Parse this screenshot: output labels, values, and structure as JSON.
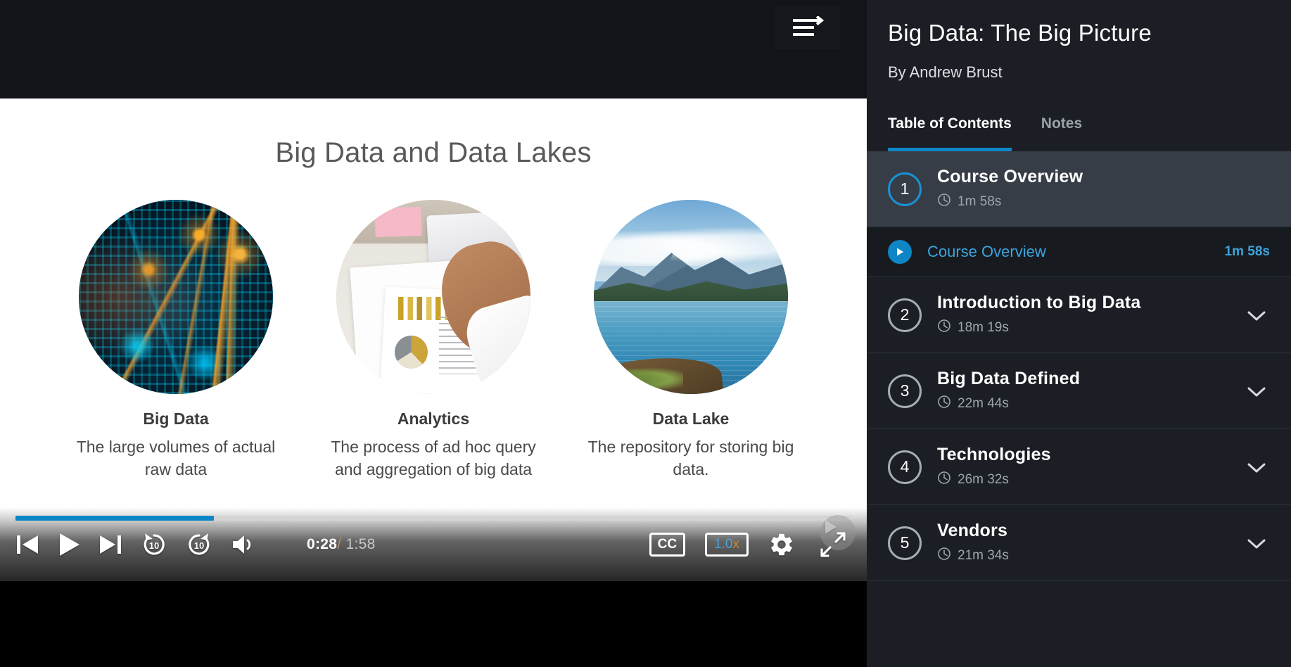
{
  "player": {
    "toggle_icon": "toc-toggle-icon",
    "slide": {
      "title": "Big Data and Data Lakes",
      "cards": [
        {
          "image": "big-data-binary-photo",
          "title": "Big Data",
          "desc": "The large volumes of actual raw data"
        },
        {
          "image": "analytics-desk-photo",
          "title": "Analytics",
          "desc": "The process of ad hoc query and aggregation of big data"
        },
        {
          "image": "data-lake-landscape-photo",
          "title": "Data Lake",
          "desc": "The repository for storing big data."
        }
      ]
    },
    "controls": {
      "previous_label": "previous-icon",
      "play_label": "play-icon",
      "next_label": "next-icon",
      "rewind_label": "10",
      "forward_label": "10",
      "volume_label": "volume-icon",
      "current_time": "0:28",
      "separator": "/",
      "total_time": "1:58",
      "cc_label": "CC",
      "speed_value": "1.0",
      "speed_suffix": "x",
      "settings_label": "gear-icon",
      "fullscreen_label": "fullscreen-icon",
      "progress_percent": 23.7
    }
  },
  "sidebar": {
    "title": "Big Data: The Big Picture",
    "author": "By Andrew Brust",
    "tabs": [
      {
        "label": "Table of Contents",
        "active": true
      },
      {
        "label": "Notes",
        "active": false
      }
    ],
    "modules": [
      {
        "number": "1",
        "title": "Course Overview",
        "duration": "1m 58s",
        "active": true,
        "expanded": true
      },
      {
        "number": "2",
        "title": "Introduction to Big Data",
        "duration": "18m 19s",
        "active": false,
        "expanded": false
      },
      {
        "number": "3",
        "title": "Big Data Defined",
        "duration": "22m 44s",
        "active": false,
        "expanded": false
      },
      {
        "number": "4",
        "title": "Technologies",
        "duration": "26m 32s",
        "active": false,
        "expanded": false
      },
      {
        "number": "5",
        "title": "Vendors",
        "duration": "21m 34s",
        "active": false,
        "expanded": false
      }
    ],
    "current_clip": {
      "title": "Course Overview",
      "duration": "1m 58s"
    }
  },
  "colors": {
    "accent": "#0e86c6",
    "accent_light": "#3ea4dd",
    "sidebar_bg": "#1b1f25",
    "sidebar_active": "#373d47",
    "clip_bg": "#171b20"
  }
}
